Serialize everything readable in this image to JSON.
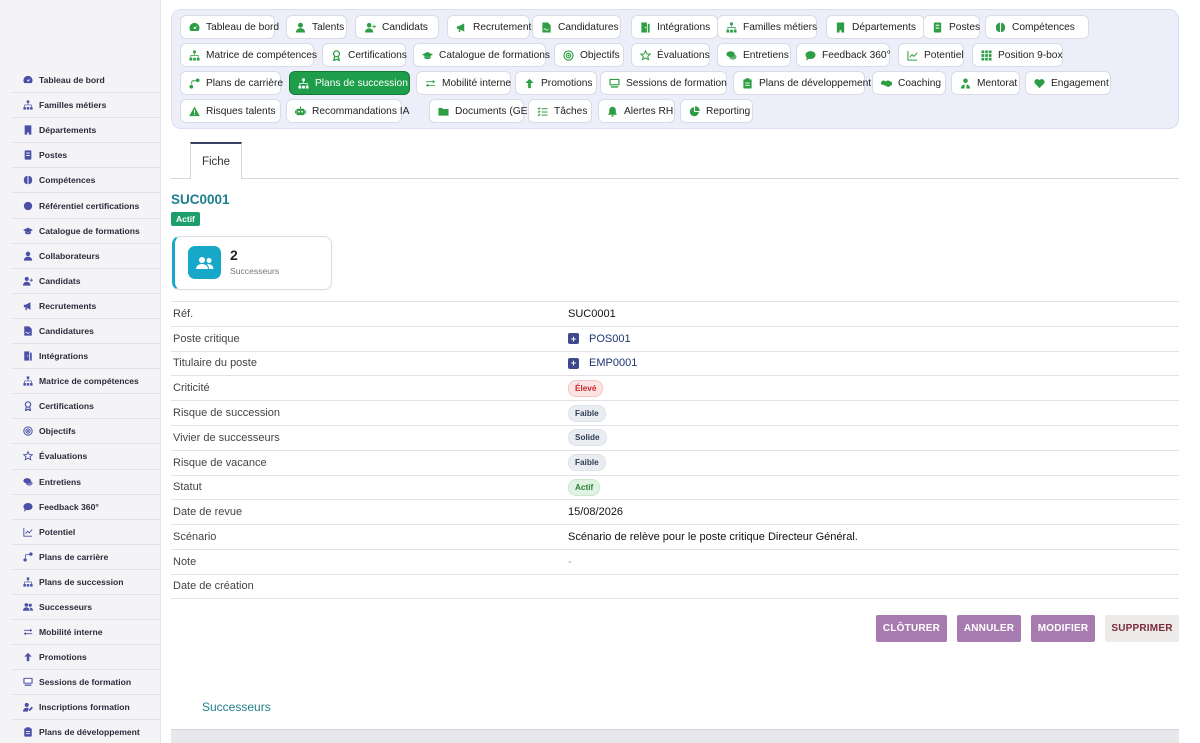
{
  "sidebar": {
    "items": [
      {
        "label": "Tableau de bord",
        "icon": "dashboard-icon"
      },
      {
        "label": "Familles métiers",
        "icon": "hierarchy-icon"
      },
      {
        "label": "Départements",
        "icon": "building-icon"
      },
      {
        "label": "Postes",
        "icon": "badge-icon"
      },
      {
        "label": "Compétences",
        "icon": "brain-icon"
      },
      {
        "label": "Référentiel certifications",
        "icon": "certificate-icon"
      },
      {
        "label": "Catalogue de formations",
        "icon": "graduation-cap-icon"
      },
      {
        "label": "Collaborateurs",
        "icon": "user-icon"
      },
      {
        "label": "Candidats",
        "icon": "user-plus-icon"
      },
      {
        "label": "Recrutements",
        "icon": "megaphone-icon"
      },
      {
        "label": "Candidatures",
        "icon": "file-signature-icon"
      },
      {
        "label": "Intégrations",
        "icon": "door-icon"
      },
      {
        "label": "Matrice de compétences",
        "icon": "hierarchy-icon"
      },
      {
        "label": "Certifications",
        "icon": "award-icon"
      },
      {
        "label": "Objectifs",
        "icon": "target-icon"
      },
      {
        "label": "Évaluations",
        "icon": "star-icon"
      },
      {
        "label": "Entretiens",
        "icon": "comments-icon"
      },
      {
        "label": "Feedback 360°",
        "icon": "comment-icon"
      },
      {
        "label": "Potentiel",
        "icon": "chart-line-icon"
      },
      {
        "label": "Plans de carrière",
        "icon": "route-icon"
      },
      {
        "label": "Plans de succession",
        "icon": "hierarchy-icon"
      },
      {
        "label": "Successeurs",
        "icon": "users-icon"
      },
      {
        "label": "Mobilité interne",
        "icon": "exchange-icon"
      },
      {
        "label": "Promotions",
        "icon": "arrow-up-icon"
      },
      {
        "label": "Sessions de formation",
        "icon": "chalkboard-icon"
      },
      {
        "label": "Inscriptions formation",
        "icon": "user-edit-icon"
      },
      {
        "label": "Plans de développement",
        "icon": "clipboard-icon"
      }
    ]
  },
  "topnav": {
    "items": [
      {
        "label": "Tableau de bord",
        "icon": "dashboard-icon"
      },
      {
        "label": "Talents",
        "icon": "user-tie-icon"
      },
      {
        "label": "Candidats",
        "icon": "user-plus-icon"
      },
      {
        "label": "Recrutements",
        "icon": "megaphone-icon"
      },
      {
        "label": "Candidatures",
        "icon": "file-signature-icon"
      },
      {
        "label": "Intégrations",
        "icon": "door-icon"
      },
      {
        "label": "Familles métiers",
        "icon": "hierarchy-icon"
      },
      {
        "label": "Départements",
        "icon": "building-icon"
      },
      {
        "label": "Postes",
        "icon": "badge-icon"
      },
      {
        "label": "Compétences",
        "icon": "brain-icon"
      },
      {
        "label": "Matrice de compétences",
        "icon": "hierarchy-icon"
      },
      {
        "label": "Certifications",
        "icon": "award-icon"
      },
      {
        "label": "Catalogue de formations",
        "icon": "graduation-cap-icon"
      },
      {
        "label": "Objectifs",
        "icon": "target-icon"
      },
      {
        "label": "Évaluations",
        "icon": "star-icon"
      },
      {
        "label": "Entretiens",
        "icon": "comments-icon"
      },
      {
        "label": "Feedback 360°",
        "icon": "comment-icon"
      },
      {
        "label": "Potentiel",
        "icon": "chart-line-icon"
      },
      {
        "label": "Position 9-box",
        "icon": "grid-icon"
      },
      {
        "label": "Plans de carrière",
        "icon": "route-icon"
      },
      {
        "label": "Plans de succession",
        "icon": "hierarchy-icon",
        "active": true
      },
      {
        "label": "Mobilité interne",
        "icon": "exchange-icon"
      },
      {
        "label": "Promotions",
        "icon": "arrow-up-icon"
      },
      {
        "label": "Sessions de formation",
        "icon": "chalkboard-icon"
      },
      {
        "label": "Plans de développement",
        "icon": "clipboard-icon"
      },
      {
        "label": "Coaching",
        "icon": "handshake-icon"
      },
      {
        "label": "Mentorat",
        "icon": "mentor-icon"
      },
      {
        "label": "Engagement",
        "icon": "heart-icon"
      },
      {
        "label": "Risques talents",
        "icon": "warning-icon"
      },
      {
        "label": "Recommandations IA",
        "icon": "robot-icon"
      },
      {
        "label": "Documents (GED)",
        "icon": "folder-icon"
      },
      {
        "label": "Tâches",
        "icon": "tasks-icon"
      },
      {
        "label": "Alertes RH",
        "icon": "bell-icon"
      },
      {
        "label": "Reporting",
        "icon": "pie-chart-icon"
      }
    ]
  },
  "tab": {
    "label": "Fiche"
  },
  "record": {
    "id": "SUC0001",
    "status": "Actif"
  },
  "stat": {
    "value": "2",
    "label": "Successeurs"
  },
  "details": [
    {
      "label": "Réf.",
      "value": "SUC0001",
      "kind": "text"
    },
    {
      "label": "Poste critique",
      "value": "POS001",
      "kind": "link"
    },
    {
      "label": "Titulaire du poste",
      "value": "EMP0001",
      "kind": "link"
    },
    {
      "label": "Criticité",
      "value": "Élevé",
      "kind": "badge",
      "color": "red"
    },
    {
      "label": "Risque de succession",
      "value": "Faible",
      "kind": "badge",
      "color": "gray"
    },
    {
      "label": "Vivier de successeurs",
      "value": "Solide",
      "kind": "badge",
      "color": "gray"
    },
    {
      "label": "Risque de vacance",
      "value": "Faible",
      "kind": "badge",
      "color": "gray"
    },
    {
      "label": "Statut",
      "value": "Actif",
      "kind": "badge",
      "color": "green"
    },
    {
      "label": "Date de revue",
      "value": "15/08/2026",
      "kind": "text"
    },
    {
      "label": "Scénario",
      "value": "Scénario de relève pour le poste critique Directeur Général.",
      "kind": "text"
    },
    {
      "label": "Note",
      "value": "-",
      "kind": "dash"
    },
    {
      "label": "Date de création",
      "value": "",
      "kind": "text"
    }
  ],
  "actions": {
    "close": "CLÔTURER",
    "cancel": "ANNULER",
    "edit": "MODIFIER",
    "delete": "SUPPRIMER"
  },
  "successors_section": {
    "title": "Successeurs"
  },
  "colors": {
    "accent": "#1e9e4a",
    "teal": "#1e7f8c",
    "action": "#a87bb0",
    "card_icon": "#17a7c8"
  }
}
